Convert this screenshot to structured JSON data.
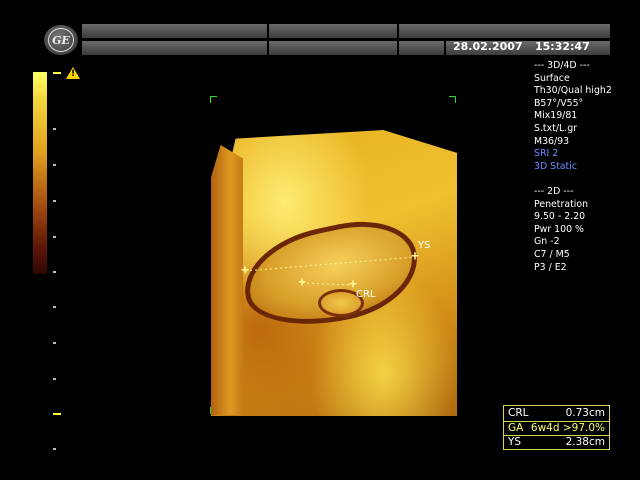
{
  "header": {
    "date": "28.02.2007",
    "time": "15:32:47",
    "logo_icon": "ge-logo-icon"
  },
  "warning_icon": "warning-icon",
  "info_panel": {
    "mode_3d4d": [
      "--- 3D/4D ---",
      "Surface",
      "Th30/Qual high2",
      "B57°/V55°",
      "Mix19/81",
      "S.txt/L.gr",
      "M36/93"
    ],
    "mode_3d4d_highlight": [
      "SRI 2",
      "3D Static"
    ],
    "mode_2d": [
      "--- 2D ---",
      "Penetration",
      "9.50 - 2.20",
      "Pwr 100 %",
      "Gn -2",
      "C7 / M5",
      "P3 / E2"
    ]
  },
  "measure_labels": {
    "ys": "YS",
    "crl": "CRL"
  },
  "results": [
    {
      "label": "CRL",
      "value": "0.73cm"
    },
    {
      "label": "GA",
      "value": "6w4d >97.0%"
    },
    {
      "label": "YS",
      "value": "2.38cm"
    }
  ],
  "colors": {
    "highlight_blue": "#6e8dff",
    "result_border": "#d8d850",
    "marker_yellow": "#fff59a"
  }
}
